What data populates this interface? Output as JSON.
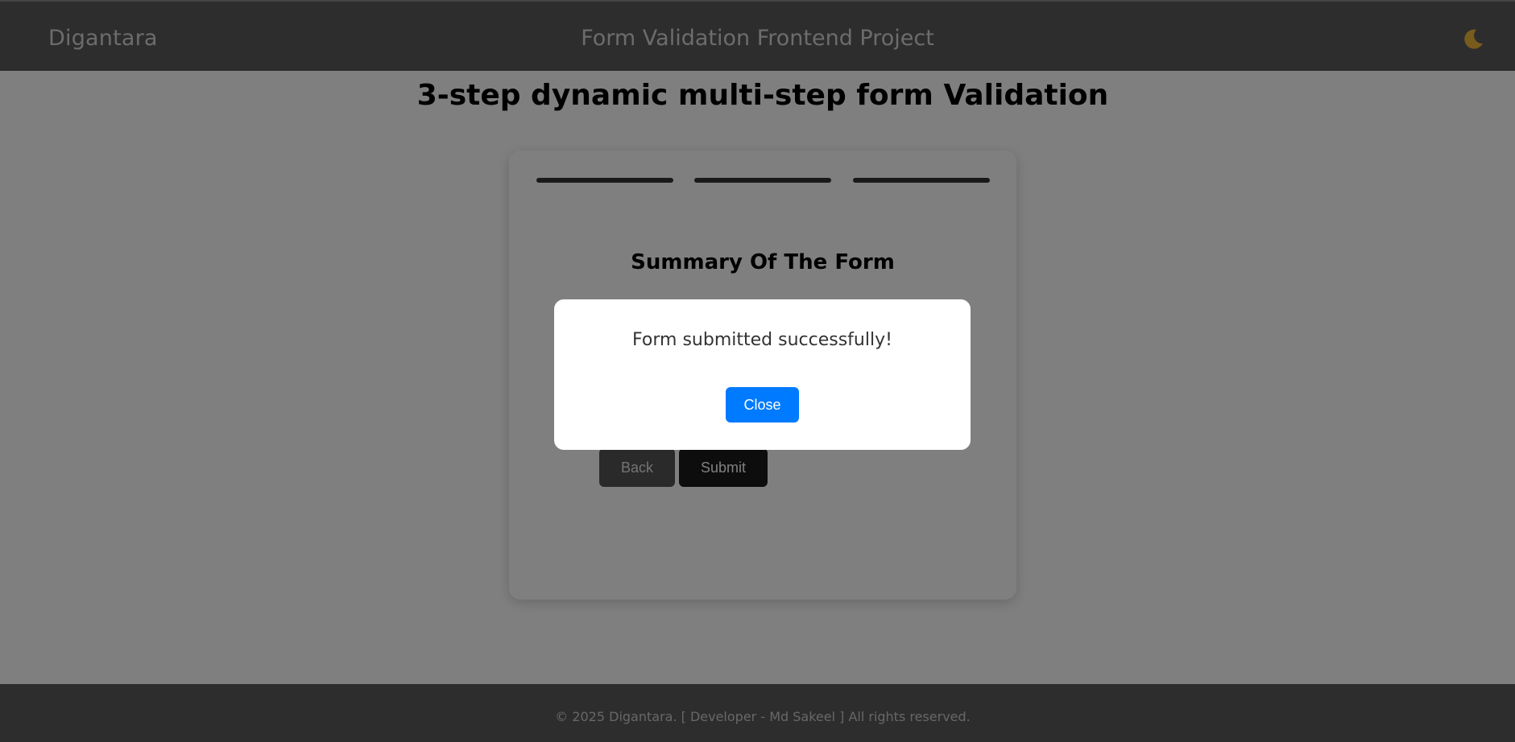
{
  "header": {
    "brand": "Digantara",
    "title": "Form Validation Frontend Project",
    "theme_icon": "moon-icon",
    "theme_icon_color": "#f0b93a"
  },
  "main": {
    "heading": "3-step dynamic multi-step form Validation",
    "steps": 3,
    "summary_title": "Summary Of The Form",
    "back_label": "Back",
    "submit_label": "Submit"
  },
  "modal": {
    "message": "Form submitted successfully!",
    "close_label": "Close",
    "close_color": "#007bff"
  },
  "footer": {
    "text": "© 2025 Digantara. [ Developer - Md Sakeel ] All rights reserved."
  }
}
